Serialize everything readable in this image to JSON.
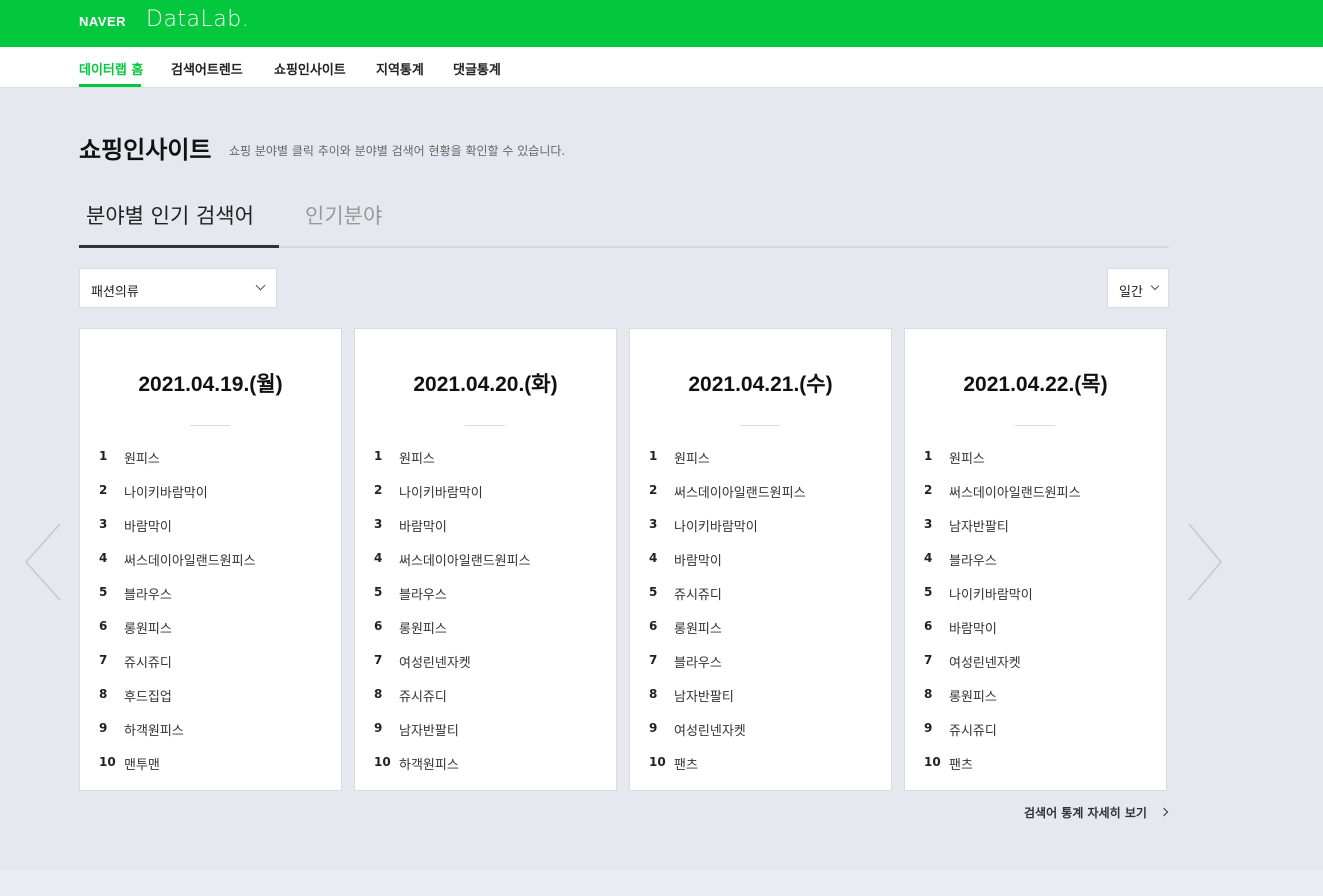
{
  "header": {
    "naver_logo": "NAVER",
    "product_logo": "DataLab."
  },
  "nav": {
    "items": [
      {
        "label": "데이터랩 홈",
        "active": true
      },
      {
        "label": "검색어트렌드",
        "active": false
      },
      {
        "label": "쇼핑인사이트",
        "active": false
      },
      {
        "label": "지역통계",
        "active": false
      },
      {
        "label": "댓글통계",
        "active": false
      }
    ]
  },
  "page": {
    "title": "쇼핑인사이트",
    "description": "쇼핑 분야별 클릭 추이와 분야별 검색어 현황을 확인할 수 있습니다."
  },
  "tabs": [
    {
      "label": "분야별 인기 검색어",
      "active": true
    },
    {
      "label": "인기분야",
      "active": false
    }
  ],
  "filters": {
    "category": "패션의류",
    "period": "일간"
  },
  "cards": [
    {
      "date": "2021.04.19.(월)",
      "ranks": [
        {
          "rank": "1",
          "keyword": "원피스"
        },
        {
          "rank": "2",
          "keyword": "나이키바람막이"
        },
        {
          "rank": "3",
          "keyword": "바람막이"
        },
        {
          "rank": "4",
          "keyword": "써스데이아일랜드원피스"
        },
        {
          "rank": "5",
          "keyword": "블라우스"
        },
        {
          "rank": "6",
          "keyword": "롱원피스"
        },
        {
          "rank": "7",
          "keyword": "쥬시쥬디"
        },
        {
          "rank": "8",
          "keyword": "후드집업"
        },
        {
          "rank": "9",
          "keyword": "하객원피스"
        },
        {
          "rank": "10",
          "keyword": "맨투맨"
        }
      ]
    },
    {
      "date": "2021.04.20.(화)",
      "ranks": [
        {
          "rank": "1",
          "keyword": "원피스"
        },
        {
          "rank": "2",
          "keyword": "나이키바람막이"
        },
        {
          "rank": "3",
          "keyword": "바람막이"
        },
        {
          "rank": "4",
          "keyword": "써스데이아일랜드원피스"
        },
        {
          "rank": "5",
          "keyword": "블라우스"
        },
        {
          "rank": "6",
          "keyword": "롱원피스"
        },
        {
          "rank": "7",
          "keyword": "여성린넨자켓"
        },
        {
          "rank": "8",
          "keyword": "쥬시쥬디"
        },
        {
          "rank": "9",
          "keyword": "남자반팔티"
        },
        {
          "rank": "10",
          "keyword": "하객원피스"
        }
      ]
    },
    {
      "date": "2021.04.21.(수)",
      "ranks": [
        {
          "rank": "1",
          "keyword": "원피스"
        },
        {
          "rank": "2",
          "keyword": "써스데이아일랜드원피스"
        },
        {
          "rank": "3",
          "keyword": "나이키바람막이"
        },
        {
          "rank": "4",
          "keyword": "바람막이"
        },
        {
          "rank": "5",
          "keyword": "쥬시쥬디"
        },
        {
          "rank": "6",
          "keyword": "롱원피스"
        },
        {
          "rank": "7",
          "keyword": "블라우스"
        },
        {
          "rank": "8",
          "keyword": "남자반팔티"
        },
        {
          "rank": "9",
          "keyword": "여성린넨자켓"
        },
        {
          "rank": "10",
          "keyword": "팬츠"
        }
      ]
    },
    {
      "date": "2021.04.22.(목)",
      "ranks": [
        {
          "rank": "1",
          "keyword": "원피스"
        },
        {
          "rank": "2",
          "keyword": "써스데이아일랜드원피스"
        },
        {
          "rank": "3",
          "keyword": "남자반팔티"
        },
        {
          "rank": "4",
          "keyword": "블라우스"
        },
        {
          "rank": "5",
          "keyword": "나이키바람막이"
        },
        {
          "rank": "6",
          "keyword": "바람막이"
        },
        {
          "rank": "7",
          "keyword": "여성린넨자켓"
        },
        {
          "rank": "8",
          "keyword": "롱원피스"
        },
        {
          "rank": "9",
          "keyword": "쥬시쥬디"
        },
        {
          "rank": "10",
          "keyword": "팬츠"
        }
      ]
    }
  ],
  "detail_link": "검색어 통계 자세히 보기",
  "icons": {
    "prev": "chevron-left-icon",
    "next": "chevron-right-icon",
    "dropdown": "chevron-down-icon",
    "link": "chevron-right-icon"
  },
  "colors": {
    "brand_green": "#03c73c",
    "background": "#e5e9ef",
    "card_border": "#d8dbe0"
  }
}
